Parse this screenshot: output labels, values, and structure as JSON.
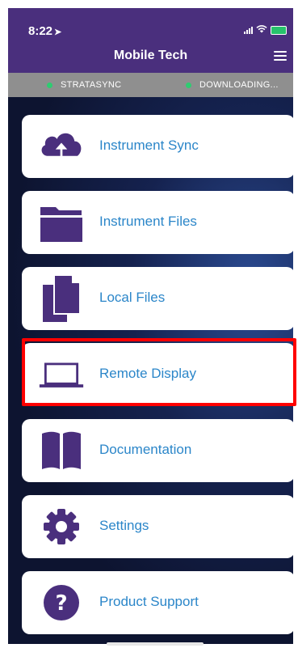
{
  "status": {
    "time": "8:22"
  },
  "header": {
    "title": "Mobile Tech"
  },
  "sync": {
    "left_label": "STRATASYNC",
    "right_label": "DOWNLOADING..."
  },
  "menu": {
    "items": [
      {
        "label": "Instrument Sync",
        "icon": "cloud-upload-icon"
      },
      {
        "label": "Instrument Files",
        "icon": "folder-icon"
      },
      {
        "label": "Local Files",
        "icon": "files-icon"
      },
      {
        "label": "Remote Display",
        "icon": "laptop-icon"
      },
      {
        "label": "Documentation",
        "icon": "book-icon"
      },
      {
        "label": "Settings",
        "icon": "gear-icon"
      },
      {
        "label": "Product Support",
        "icon": "question-circle-icon"
      }
    ]
  },
  "colors": {
    "primary": "#4a2f7d",
    "link": "#2b86c9",
    "highlight": "#ff0000",
    "status_dot": "#2ecc71"
  }
}
